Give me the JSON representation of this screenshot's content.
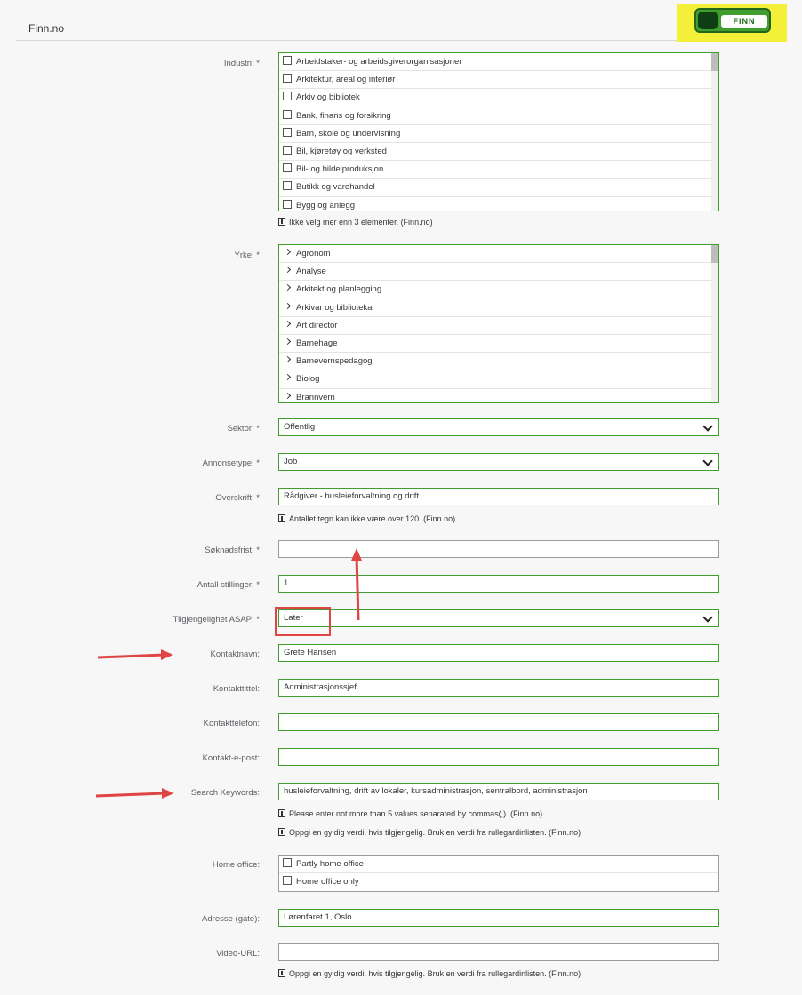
{
  "header": {
    "title": "Finn.no",
    "logo_text": "FINN"
  },
  "colors": {
    "field_border": "#3f9e2e",
    "annotation": "#e04545",
    "logo_bg": "#f4f03a"
  },
  "industri": {
    "label": "Industri: *",
    "items": [
      "Arbeidstaker- og arbeidsgiverorganisasjoner",
      "Arkitektur, areal og interiør",
      "Arkiv og bibliotek",
      "Bank, finans og forsikring",
      "Barn, skole og undervisning",
      "Bil, kjøretøy og verksted",
      "Bil- og bildelproduksjon",
      "Butikk og varehandel",
      "Bygg og anlegg"
    ],
    "hint": "Ikke velg mer enn 3 elementer. (Finn.no)"
  },
  "yrke": {
    "label": "Yrke: *",
    "items": [
      "Agronom",
      "Analyse",
      "Arkitekt og planlegging",
      "Arkivar og bibliotekar",
      "Art director",
      "Barnehage",
      "Barnevernspedagog",
      "Biolog",
      "Brannvern"
    ]
  },
  "sektor": {
    "label": "Sektor: *",
    "value": "Offentlig"
  },
  "annonsetype": {
    "label": "Annonsetype: *",
    "value": "Job"
  },
  "overskrift": {
    "label": "Overskrift: *",
    "value": "Rådgiver - husleieforvaltning og drift",
    "hint": "Antallet tegn kan ikke være over 120. (Finn.no)"
  },
  "soknadsfrist": {
    "label": "Søknadsfrist: *",
    "value": ""
  },
  "antall": {
    "label": "Antall stillinger: *",
    "value": "1"
  },
  "tilgjengelighet": {
    "label": "Tilgjengelighet ASAP: *",
    "value": "Later"
  },
  "kontaktnavn": {
    "label": "Kontaktnavn:",
    "value": "Grete Hansen"
  },
  "kontakttittel": {
    "label": "Kontakttittel:",
    "value": "Administrasjonssjef"
  },
  "kontakttelefon": {
    "label": "Kontakttelefon:",
    "value": ""
  },
  "kontaktepost": {
    "label": "Kontakt-e-post:",
    "value": ""
  },
  "keywords": {
    "label": "Search Keywords:",
    "value": "husleieforvaltning, drift av lokaler, kursadministrasjon, sentralbord, administrasjon",
    "hint1": "Please enter not more than 5 values separated by commas(,). (Finn.no)",
    "hint2": "Oppgi en gyldig verdi, hvis tilgjengelig. Bruk en verdi fra rullegardinlisten. (Finn.no)"
  },
  "homeoffice": {
    "label": "Home office:",
    "items": [
      "Partly home office",
      "Home office only"
    ]
  },
  "adresse": {
    "label": "Adresse (gate):",
    "value": "Lørenfaret 1, Oslo"
  },
  "video": {
    "label": "Video-URL:",
    "value": "",
    "hint": "Oppgi en gyldig verdi, hvis tilgjengelig. Bruk en verdi fra rullegardinlisten. (Finn.no)"
  }
}
